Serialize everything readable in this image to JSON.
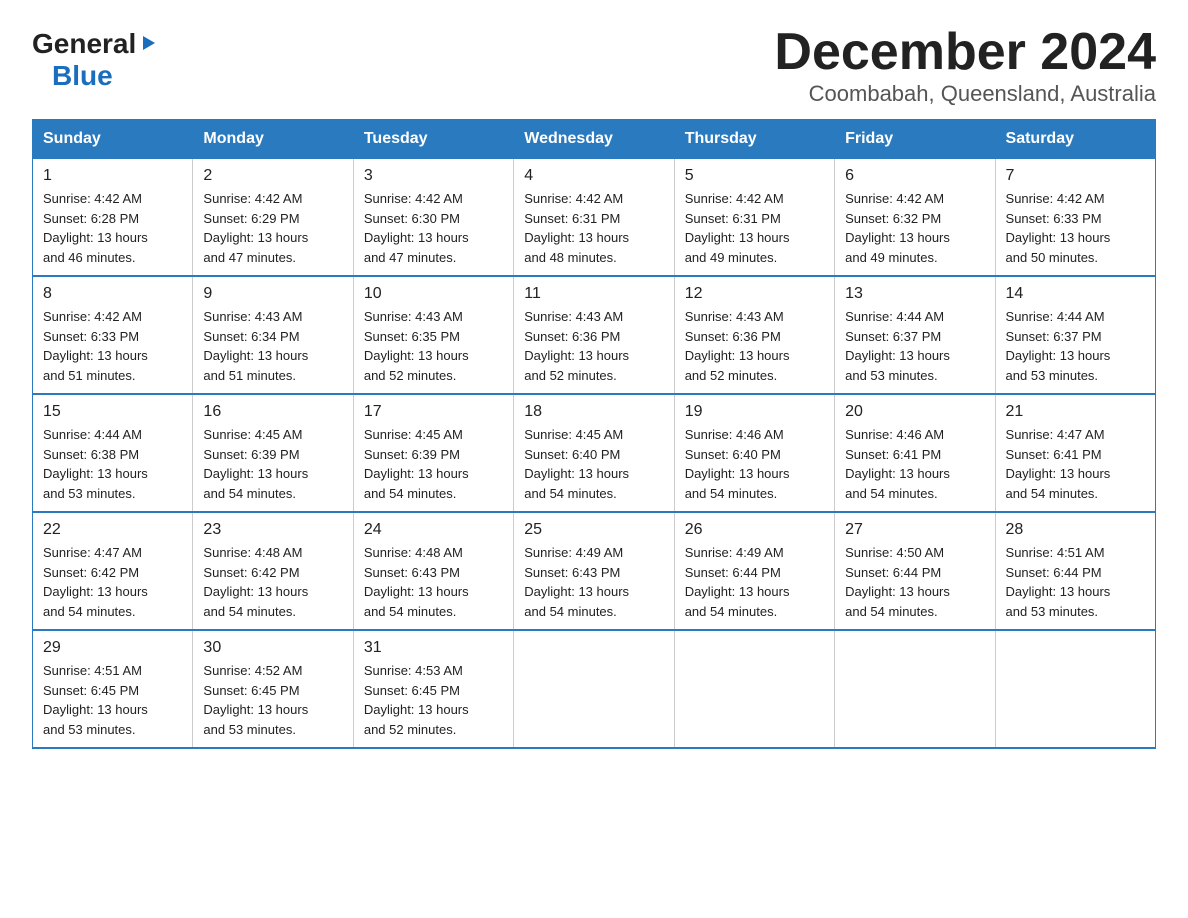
{
  "logo": {
    "general": "General",
    "blue": "Blue",
    "arrow": "▶"
  },
  "title": "December 2024",
  "subtitle": "Coombabah, Queensland, Australia",
  "headers": [
    "Sunday",
    "Monday",
    "Tuesday",
    "Wednesday",
    "Thursday",
    "Friday",
    "Saturday"
  ],
  "weeks": [
    [
      {
        "day": "1",
        "sunrise": "4:42 AM",
        "sunset": "6:28 PM",
        "daylight": "13 hours and 46 minutes."
      },
      {
        "day": "2",
        "sunrise": "4:42 AM",
        "sunset": "6:29 PM",
        "daylight": "13 hours and 47 minutes."
      },
      {
        "day": "3",
        "sunrise": "4:42 AM",
        "sunset": "6:30 PM",
        "daylight": "13 hours and 47 minutes."
      },
      {
        "day": "4",
        "sunrise": "4:42 AM",
        "sunset": "6:31 PM",
        "daylight": "13 hours and 48 minutes."
      },
      {
        "day": "5",
        "sunrise": "4:42 AM",
        "sunset": "6:31 PM",
        "daylight": "13 hours and 49 minutes."
      },
      {
        "day": "6",
        "sunrise": "4:42 AM",
        "sunset": "6:32 PM",
        "daylight": "13 hours and 49 minutes."
      },
      {
        "day": "7",
        "sunrise": "4:42 AM",
        "sunset": "6:33 PM",
        "daylight": "13 hours and 50 minutes."
      }
    ],
    [
      {
        "day": "8",
        "sunrise": "4:42 AM",
        "sunset": "6:33 PM",
        "daylight": "13 hours and 51 minutes."
      },
      {
        "day": "9",
        "sunrise": "4:43 AM",
        "sunset": "6:34 PM",
        "daylight": "13 hours and 51 minutes."
      },
      {
        "day": "10",
        "sunrise": "4:43 AM",
        "sunset": "6:35 PM",
        "daylight": "13 hours and 52 minutes."
      },
      {
        "day": "11",
        "sunrise": "4:43 AM",
        "sunset": "6:36 PM",
        "daylight": "13 hours and 52 minutes."
      },
      {
        "day": "12",
        "sunrise": "4:43 AM",
        "sunset": "6:36 PM",
        "daylight": "13 hours and 52 minutes."
      },
      {
        "day": "13",
        "sunrise": "4:44 AM",
        "sunset": "6:37 PM",
        "daylight": "13 hours and 53 minutes."
      },
      {
        "day": "14",
        "sunrise": "4:44 AM",
        "sunset": "6:37 PM",
        "daylight": "13 hours and 53 minutes."
      }
    ],
    [
      {
        "day": "15",
        "sunrise": "4:44 AM",
        "sunset": "6:38 PM",
        "daylight": "13 hours and 53 minutes."
      },
      {
        "day": "16",
        "sunrise": "4:45 AM",
        "sunset": "6:39 PM",
        "daylight": "13 hours and 54 minutes."
      },
      {
        "day": "17",
        "sunrise": "4:45 AM",
        "sunset": "6:39 PM",
        "daylight": "13 hours and 54 minutes."
      },
      {
        "day": "18",
        "sunrise": "4:45 AM",
        "sunset": "6:40 PM",
        "daylight": "13 hours and 54 minutes."
      },
      {
        "day": "19",
        "sunrise": "4:46 AM",
        "sunset": "6:40 PM",
        "daylight": "13 hours and 54 minutes."
      },
      {
        "day": "20",
        "sunrise": "4:46 AM",
        "sunset": "6:41 PM",
        "daylight": "13 hours and 54 minutes."
      },
      {
        "day": "21",
        "sunrise": "4:47 AM",
        "sunset": "6:41 PM",
        "daylight": "13 hours and 54 minutes."
      }
    ],
    [
      {
        "day": "22",
        "sunrise": "4:47 AM",
        "sunset": "6:42 PM",
        "daylight": "13 hours and 54 minutes."
      },
      {
        "day": "23",
        "sunrise": "4:48 AM",
        "sunset": "6:42 PM",
        "daylight": "13 hours and 54 minutes."
      },
      {
        "day": "24",
        "sunrise": "4:48 AM",
        "sunset": "6:43 PM",
        "daylight": "13 hours and 54 minutes."
      },
      {
        "day": "25",
        "sunrise": "4:49 AM",
        "sunset": "6:43 PM",
        "daylight": "13 hours and 54 minutes."
      },
      {
        "day": "26",
        "sunrise": "4:49 AM",
        "sunset": "6:44 PM",
        "daylight": "13 hours and 54 minutes."
      },
      {
        "day": "27",
        "sunrise": "4:50 AM",
        "sunset": "6:44 PM",
        "daylight": "13 hours and 54 minutes."
      },
      {
        "day": "28",
        "sunrise": "4:51 AM",
        "sunset": "6:44 PM",
        "daylight": "13 hours and 53 minutes."
      }
    ],
    [
      {
        "day": "29",
        "sunrise": "4:51 AM",
        "sunset": "6:45 PM",
        "daylight": "13 hours and 53 minutes."
      },
      {
        "day": "30",
        "sunrise": "4:52 AM",
        "sunset": "6:45 PM",
        "daylight": "13 hours and 53 minutes."
      },
      {
        "day": "31",
        "sunrise": "4:53 AM",
        "sunset": "6:45 PM",
        "daylight": "13 hours and 52 minutes."
      },
      null,
      null,
      null,
      null
    ]
  ],
  "cell_labels": {
    "sunrise": "Sunrise: ",
    "sunset": "Sunset: ",
    "daylight": "Daylight: "
  },
  "accent_color": "#2a7abf"
}
